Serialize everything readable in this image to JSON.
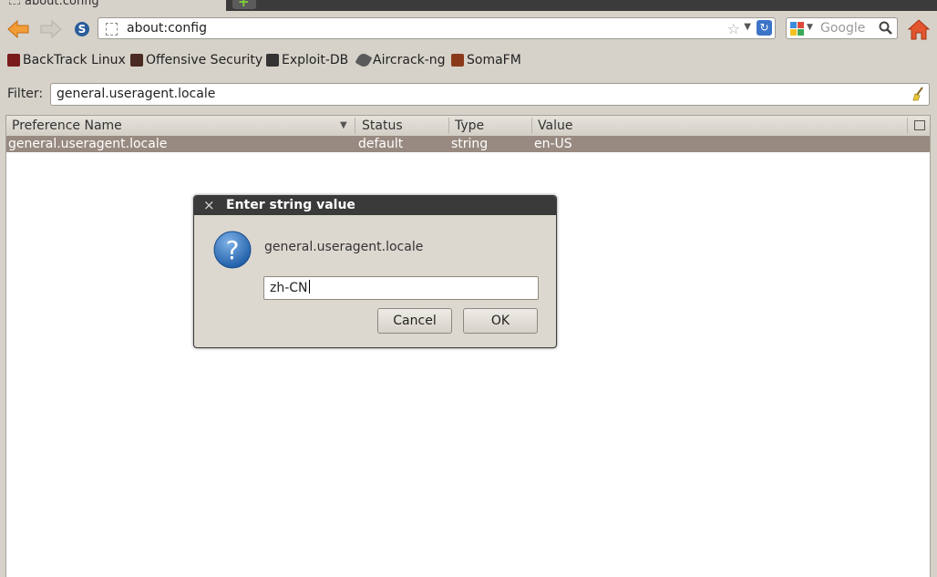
{
  "tab": {
    "title": "about:config"
  },
  "navbar": {
    "url": "about:config"
  },
  "search": {
    "placeholder": "Google"
  },
  "bookmarks": [
    {
      "label": "BackTrack Linux",
      "icon": "backtrack-icon"
    },
    {
      "label": "Offensive Security",
      "icon": "offsec-icon"
    },
    {
      "label": "Exploit-DB",
      "icon": "exploitdb-icon"
    },
    {
      "label": "Aircrack-ng",
      "icon": "aircrack-icon"
    },
    {
      "label": "SomaFM",
      "icon": "somafm-icon"
    }
  ],
  "filter": {
    "label": "Filter:",
    "value": "general.useragent.locale"
  },
  "table": {
    "columns": [
      "Preference Name",
      "Status",
      "Type",
      "Value"
    ],
    "rows": [
      {
        "name": "general.useragent.locale",
        "status": "default",
        "type": "string",
        "value": "en-US"
      }
    ]
  },
  "dialog": {
    "title": "Enter string value",
    "message": "general.useragent.locale",
    "input_value": "zh-CN",
    "cancel_label": "Cancel",
    "ok_label": "OK"
  },
  "colors": {
    "selected_row": "#988a80",
    "titlebar": "#3a3a3a",
    "background": "#d6d2ca"
  }
}
